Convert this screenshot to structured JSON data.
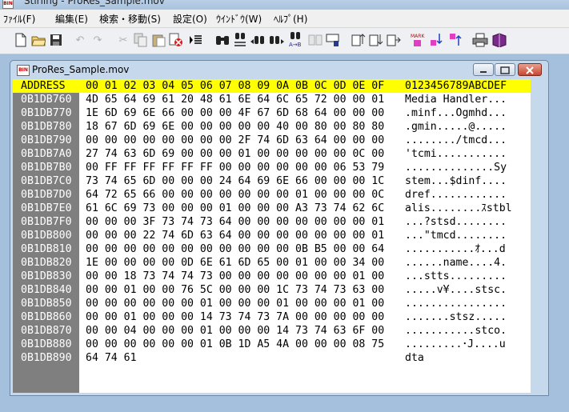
{
  "window": {
    "title": "Stirling - ProRes_Sample.mov",
    "icon": "app-icon"
  },
  "menu": [
    {
      "label": "ﾌｧｲﾙ(F)"
    },
    {
      "label": "編集(E)"
    },
    {
      "label": "検索・移動(S)"
    },
    {
      "label": "設定(O)"
    },
    {
      "label": "ｳｲﾝﾄﾞｳ(W)"
    },
    {
      "label": "ﾍﾙﾌﾟ(H)"
    }
  ],
  "toolbar": [
    "new-file-icon",
    "open-folder-icon",
    "save-icon",
    "undo-icon",
    "redo-icon",
    "cut-icon",
    "copy-icon",
    "paste-icon",
    "delete-icon",
    "insert-mode-icon",
    "find-icon",
    "find-hex-icon",
    "find-prev-icon",
    "find-next-icon",
    "replace-icon",
    "compare-icon",
    "jump-icon",
    "select-start-icon",
    "select-end-icon",
    "select-range-icon",
    "set-mark-icon",
    "next-mark-icon",
    "prev-mark-icon",
    "print-icon",
    "help-book-icon"
  ],
  "document": {
    "title": "ProRes_Sample.mov",
    "icon_label": "BIN",
    "header": {
      "address": "ADDRESS",
      "hex": "00 01 02 03 04 05 06 07 08 09 0A 0B 0C 0D 0E 0F",
      "ascii": "0123456789ABCDEF"
    },
    "rows": [
      {
        "addr": "0B1DB760",
        "hex": "4D 65 64 69 61 20 48 61 6E 64 6C 65 72 00 00 01",
        "ascii": "Media Handler..."
      },
      {
        "addr": "0B1DB770",
        "hex": "1E 6D 69 6E 66 00 00 00 4F 67 6D 68 64 00 00 00",
        "ascii": ".minf...Ogmhd..."
      },
      {
        "addr": "0B1DB780",
        "hex": "18 67 6D 69 6E 00 00 00 00 00 40 00 80 00 80 80",
        "ascii": ".gmin.....@....."
      },
      {
        "addr": "0B1DB790",
        "hex": "00 00 00 00 00 00 00 00 2F 74 6D 63 64 00 00 00",
        "ascii": "......../tmcd..."
      },
      {
        "addr": "0B1DB7A0",
        "hex": "27 74 63 6D 69 00 00 00 01 00 00 00 00 00 0C 00",
        "ascii": "'tcmi..........."
      },
      {
        "addr": "0B1DB7B0",
        "hex": "00 FF FF FF FF FF FF 00 00 00 00 00 00 06 53 79",
        "ascii": "..............Sy"
      },
      {
        "addr": "0B1DB7C0",
        "hex": "73 74 65 6D 00 00 00 24 64 69 6E 66 00 00 00 1C",
        "ascii": "stem...$dinf...."
      },
      {
        "addr": "0B1DB7D0",
        "hex": "64 72 65 66 00 00 00 00 00 00 00 01 00 00 00 0C",
        "ascii": "dref............"
      },
      {
        "addr": "0B1DB7E0",
        "hex": "61 6C 69 73 00 00 00 01 00 00 00 A3 73 74 62 6C",
        "ascii": "alis........ｽstbl"
      },
      {
        "addr": "0B1DB7F0",
        "hex": "00 00 00 3F 73 74 73 64 00 00 00 00 00 00 00 01",
        "ascii": "...?stsd........"
      },
      {
        "addr": "0B1DB800",
        "hex": "00 00 00 22 74 6D 63 64 00 00 00 00 00 00 00 01",
        "ascii": "...\"tmcd........"
      },
      {
        "addr": "0B1DB810",
        "hex": "00 00 00 00 00 00 00 00 00 00 00 0B B5 00 00 64",
        "ascii": "...........ｵ...d"
      },
      {
        "addr": "0B1DB820",
        "hex": "1E 00 00 00 00 0D 6E 61 6D 65 00 01 00 00 34 00",
        "ascii": "......name....4."
      },
      {
        "addr": "0B1DB830",
        "hex": "00 00 18 73 74 74 73 00 00 00 00 00 00 00 01 00",
        "ascii": "...stts........."
      },
      {
        "addr": "0B1DB840",
        "hex": "00 00 01 00 00 76 5C 00 00 00 1C 73 74 73 63 00",
        "ascii": ".....v¥....stsc."
      },
      {
        "addr": "0B1DB850",
        "hex": "00 00 00 00 00 00 01 00 00 00 01 00 00 00 01 00",
        "ascii": "................"
      },
      {
        "addr": "0B1DB860",
        "hex": "00 00 01 00 00 00 14 73 74 73 7A 00 00 00 00 00",
        "ascii": ".......stsz....."
      },
      {
        "addr": "0B1DB870",
        "hex": "00 00 04 00 00 00 01 00 00 00 14 73 74 63 6F 00",
        "ascii": "...........stco."
      },
      {
        "addr": "0B1DB880",
        "hex": "00 00 00 00 00 00 01 0B 1D A5 4A 00 00 00 08 75",
        "ascii": ".........･J....u"
      },
      {
        "addr": "0B1DB890",
        "hex": "64 74 61",
        "ascii": "dta"
      }
    ]
  }
}
